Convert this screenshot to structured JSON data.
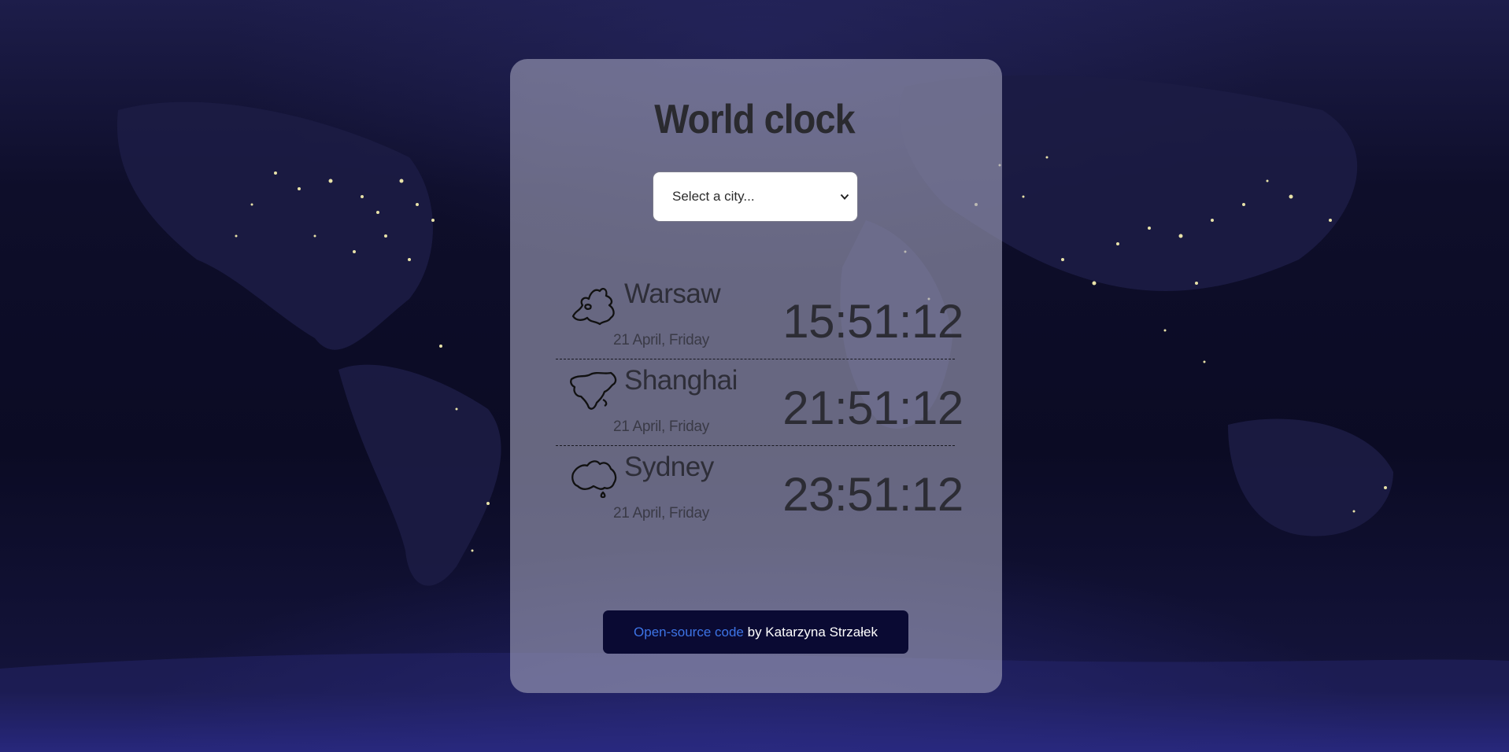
{
  "app": {
    "title": "World clock"
  },
  "city_select": {
    "selected_label": "Select a city..."
  },
  "cities": [
    {
      "name": "Warsaw",
      "date": "21 April, Friday",
      "time": "15:51:12",
      "icon": "europe-continent-icon"
    },
    {
      "name": "Shanghai",
      "date": "21 April, Friday",
      "time": "21:51:12",
      "icon": "asia-continent-icon"
    },
    {
      "name": "Sydney",
      "date": "21 April, Friday",
      "time": "23:51:12",
      "icon": "australia-continent-icon"
    }
  ],
  "footer": {
    "link_label": "Open-source code",
    "author_text": "by Katarzyna Strzałek"
  },
  "colors": {
    "background": "#0f0f2e",
    "card": "#a0a0b9",
    "footer_bg": "#0a0a33",
    "link": "#3d74e6"
  }
}
